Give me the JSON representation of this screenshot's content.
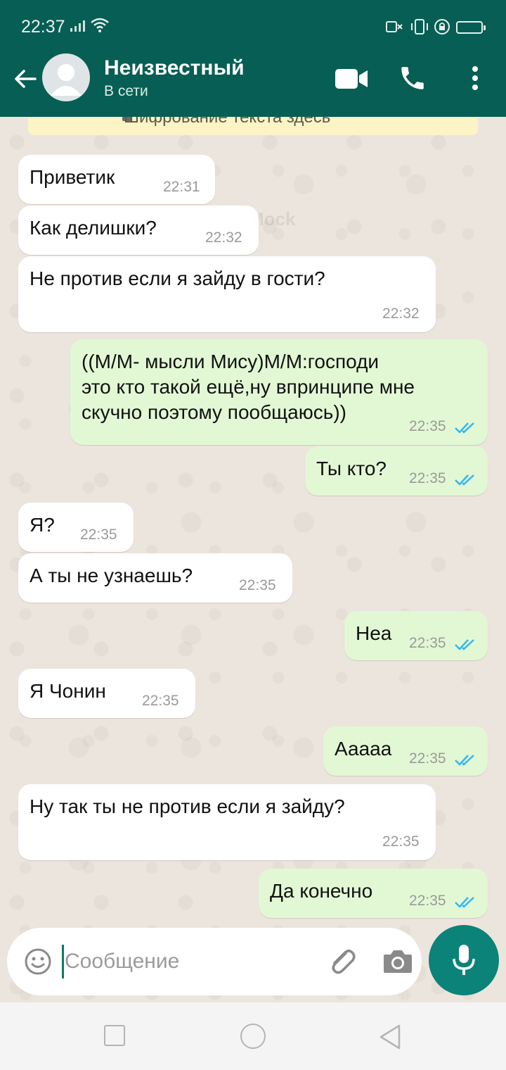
{
  "status_bar": {
    "time": "22:37"
  },
  "header": {
    "contact_name": "Неизвестный",
    "status": "В сети",
    "icons": [
      "back-arrow-icon",
      "avatar",
      "video-call-icon",
      "phone-icon",
      "more-icon"
    ]
  },
  "watermark": "WhatsMock",
  "encryption_notice": "Шифрование текста здесь",
  "messages": [
    {
      "direction": "in",
      "text": [
        "Приветик"
      ],
      "time": "22:31"
    },
    {
      "direction": "in",
      "text": [
        "Как делишки?"
      ],
      "time": "22:32"
    },
    {
      "direction": "in",
      "text": [
        "Не против если я зайду в гости?"
      ],
      "time": "22:32"
    },
    {
      "direction": "out",
      "text": [
        "((М/М- мысли Мису)М/М:господи",
        "это кто такой ещё,ну впринципе мне",
        "скучно поэтому пообщаюсь))"
      ],
      "time": "22:35",
      "read": true
    },
    {
      "direction": "out",
      "text": [
        "Ты кто?"
      ],
      "time": "22:35",
      "read": true
    },
    {
      "direction": "in",
      "text": [
        "Я?"
      ],
      "time": "22:35"
    },
    {
      "direction": "in",
      "text": [
        "А ты не узнаешь?"
      ],
      "time": "22:35"
    },
    {
      "direction": "out",
      "text": [
        "Неа"
      ],
      "time": "22:35",
      "read": true
    },
    {
      "direction": "in",
      "text": [
        "Я Чонин"
      ],
      "time": "22:35"
    },
    {
      "direction": "out",
      "text": [
        "Ааааа"
      ],
      "time": "22:35",
      "read": true
    },
    {
      "direction": "in",
      "text": [
        "Ну так ты не против если я зайду?"
      ],
      "time": "22:35"
    },
    {
      "direction": "out",
      "text": [
        "Да конечно"
      ],
      "time": "22:35",
      "read": true
    }
  ],
  "composer": {
    "placeholder": "Сообщение",
    "value": "",
    "icons": [
      "emoji-icon",
      "attach-icon",
      "camera-icon",
      "mic-icon"
    ]
  },
  "colors": {
    "header": "#075e54",
    "outgoing_bubble": "#e2f8d4",
    "incoming_bubble": "#ffffff",
    "read_ticks": "#34b7f1",
    "mic_button": "#0b8378"
  }
}
